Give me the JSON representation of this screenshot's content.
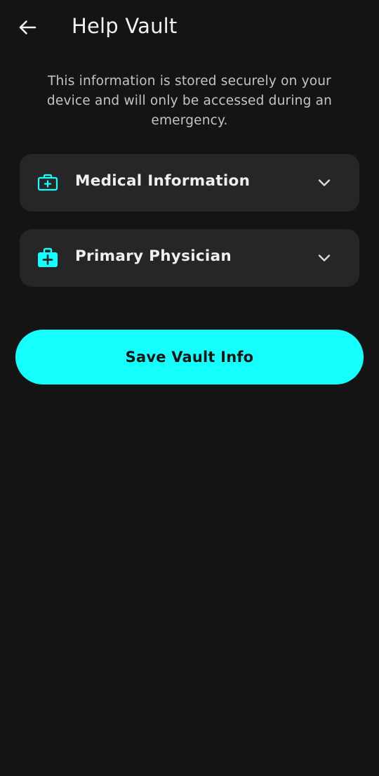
{
  "header": {
    "back_icon": "arrow-left-icon",
    "title": "Help Vault"
  },
  "intro": {
    "text": "This information is stored securely on your device and will only be accessed during an emergency."
  },
  "sections": [
    {
      "label": "Medical Information",
      "icon": "medical-kit-outline-icon",
      "expanded": false
    },
    {
      "label": "Primary Physician",
      "icon": "medical-bag-filled-icon",
      "expanded": false
    }
  ],
  "actions": {
    "save_label": "Save Vault Info"
  },
  "colors": {
    "background": "#141414",
    "card": "#262626",
    "accent": "#15ffff",
    "text": "#efefef",
    "muted_text": "#c4c4c4"
  }
}
